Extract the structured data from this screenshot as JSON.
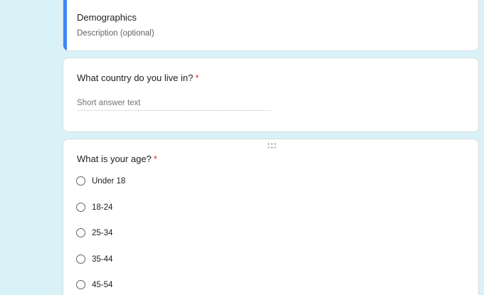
{
  "section": {
    "title": "Demographics",
    "description": "Description (optional)",
    "accent_color": "#4285f4"
  },
  "questions": [
    {
      "title": "What country do you live in?",
      "required_mark": "*",
      "type": "short-answer",
      "placeholder": "Short answer text"
    },
    {
      "title": "What is your age?",
      "required_mark": "*",
      "type": "multiple-choice",
      "options": [
        "Under 18",
        "18-24",
        "25-34",
        "35-44",
        "45-54"
      ]
    }
  ],
  "colors": {
    "background": "#d8f2f8",
    "required": "#d93025",
    "card": "#ffffff"
  },
  "icons": {
    "drag_handle": "drag-handle-icon",
    "radio": "radio-unchecked-icon"
  }
}
